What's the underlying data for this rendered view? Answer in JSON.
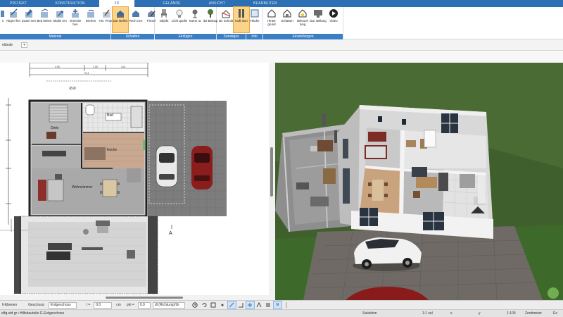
{
  "tabs": [
    {
      "label": "PROJEKT"
    },
    {
      "label": "KONSTRUKTION"
    },
    {
      "label": "3D",
      "active": true
    },
    {
      "label": "GELÄNDE"
    },
    {
      "label": "ANSICHT"
    },
    {
      "label": "BEARBEITEN"
    }
  ],
  "ribbon": {
    "groups": [
      {
        "name": "Material",
        "buttons": [
          {
            "label": "n",
            "icon": "partial-icon"
          },
          {
            "label": "Abgrei fen",
            "icon": "eyedropper-icon"
          },
          {
            "label": "Zuwei sen",
            "icon": "assign-icon"
          },
          {
            "label": "Bea beiten",
            "icon": "edit-icon"
          },
          {
            "label": "Skalie ren",
            "icon": "scale-icon"
          },
          {
            "label": "Verschie ben",
            "icon": "move-icon"
          },
          {
            "label": "Drehen",
            "icon": "rotate-icon"
          },
          {
            "label": "Hin. Pinsel",
            "icon": "brush-icon"
          }
        ]
      },
      {
        "name": "Schatten",
        "buttons": [
          {
            "label": "Dar stellen",
            "icon": "shadow-display-icon",
            "active": true
          },
          {
            "label": "Rech nen",
            "icon": "shadow-calc-icon"
          },
          {
            "label": "Pinsel",
            "icon": "shadow-brush-icon"
          }
        ]
      },
      {
        "name": "Einfügen",
        "buttons": [
          {
            "label": "Objekt",
            "icon": "chair-icon"
          },
          {
            "label": "Licht quelle",
            "icon": "lightbulb-icon"
          },
          {
            "label": "Kame ra",
            "icon": "camera-icon"
          },
          {
            "label": "3D Bitmap",
            "icon": "tree-icon"
          }
        ]
      },
      {
        "name": "Sonstiges",
        "buttons": [
          {
            "label": "3D Schnitt",
            "icon": "section-icon"
          },
          {
            "label": "Kulli sion",
            "icon": "collision-icon",
            "active": true
          }
        ]
      },
      {
        "name": "Info",
        "buttons": [
          {
            "label": "Fläche",
            "icon": "area-icon"
          }
        ]
      },
      {
        "name": "Einstellungen",
        "buttons": [
          {
            "label": "Hinter grund",
            "icon": "background-icon"
          },
          {
            "label": "Schatten",
            "icon": "house-shadow-icon"
          },
          {
            "label": "Beleuch tung",
            "icon": "house-light-icon"
          },
          {
            "label": "Dar stellung",
            "icon": "display-icon"
          },
          {
            "label": "Video",
            "icon": "play-icon"
          }
        ]
      }
    ]
  },
  "view_selector": {
    "value": "elände"
  },
  "plan": {
    "room_labels": {
      "diele": "Diele",
      "bad": "Bad",
      "kueche": "Küche",
      "wohnzimmer": "Wohnzimmer"
    },
    "section_marker": "A",
    "dimension_labels": [
      "4.00",
      "1.00",
      "4.11",
      "9.11"
    ]
  },
  "bottom_toolbar": {
    "layers": "ll-Ebenen",
    "floor_label": "Geschoss:",
    "floor_value": "Erdgeschoss",
    "x_label": "l =",
    "x_value": "0.0",
    "x_unit": "cm",
    "phi_label": "phi =",
    "phi_value": "0.0",
    "mode_value": "dl (Richtung)/Ur",
    "snap_letter": "N"
  },
  "status": {
    "left": "effg.std gr ι Hilfsbauteile G-Erdgeschoss",
    "selection": "Selektion",
    "scale_left": "1:1 sel",
    "x": "x",
    "y": "y",
    "scale": "1:100",
    "unit": "Zentimeter",
    "mode": "Ex"
  },
  "colors": {
    "accent": "#2c6fb5",
    "active_button": "#fbd48a",
    "grass": "#3f5f2c",
    "paving": "#6f6a65"
  }
}
